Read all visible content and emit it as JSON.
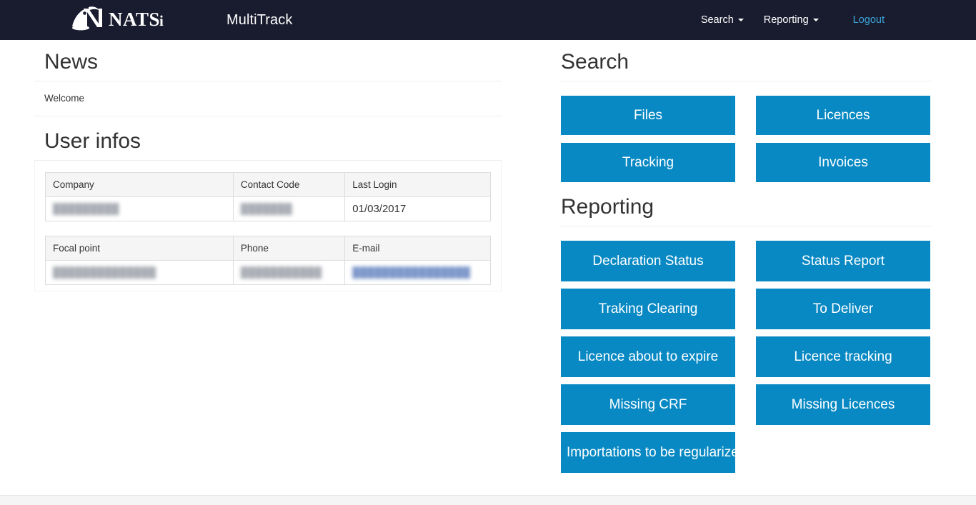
{
  "navbar": {
    "brand_name": "NATSi",
    "app_title": "MultiTrack",
    "menu": [
      {
        "label": "Search",
        "has_caret": true,
        "icon": "chevron-down-icon"
      },
      {
        "label": "Reporting",
        "has_caret": true,
        "icon": "chevron-down-icon"
      }
    ],
    "logout_label": "Logout",
    "background_color": "#191b2e",
    "logout_color": "#3aa5d8"
  },
  "news": {
    "heading": "News",
    "items": [
      "Welcome"
    ]
  },
  "user_infos": {
    "heading": "User infos",
    "table_primary": {
      "headers": [
        "Company",
        "Contact Code",
        "Last Login"
      ],
      "rows": [
        [
          {
            "value": "█████████",
            "redacted": true
          },
          {
            "value": "███████",
            "redacted": true
          },
          {
            "value": "01/03/2017",
            "redacted": false
          }
        ]
      ]
    },
    "table_secondary": {
      "headers": [
        "Focal point",
        "Phone",
        "E-mail"
      ],
      "rows": [
        [
          {
            "value": "██████████████",
            "redacted": true
          },
          {
            "value": "███████████",
            "redacted": true
          },
          {
            "value": "████████████████",
            "redacted": true,
            "link": true
          }
        ]
      ]
    }
  },
  "search": {
    "heading": "Search",
    "buttons": [
      {
        "label": "Files"
      },
      {
        "label": "Licences"
      },
      {
        "label": "Tracking"
      },
      {
        "label": "Invoices"
      }
    ]
  },
  "reporting": {
    "heading": "Reporting",
    "buttons": [
      {
        "label": "Declaration Status"
      },
      {
        "label": "Status Report"
      },
      {
        "label": "Traking Clearing"
      },
      {
        "label": "To Deliver"
      },
      {
        "label": "Licence about to expire"
      },
      {
        "label": "Licence tracking"
      },
      {
        "label": "Missing CRF"
      },
      {
        "label": "Missing Licences"
      },
      {
        "label": "Importations to be regularized"
      }
    ]
  },
  "theme": {
    "button_blue": "#0889c3",
    "navbar_dark": "#191b2e",
    "text_dark": "#333333",
    "table_header_bg": "#f5f5f5",
    "border_light": "#dddddd"
  }
}
